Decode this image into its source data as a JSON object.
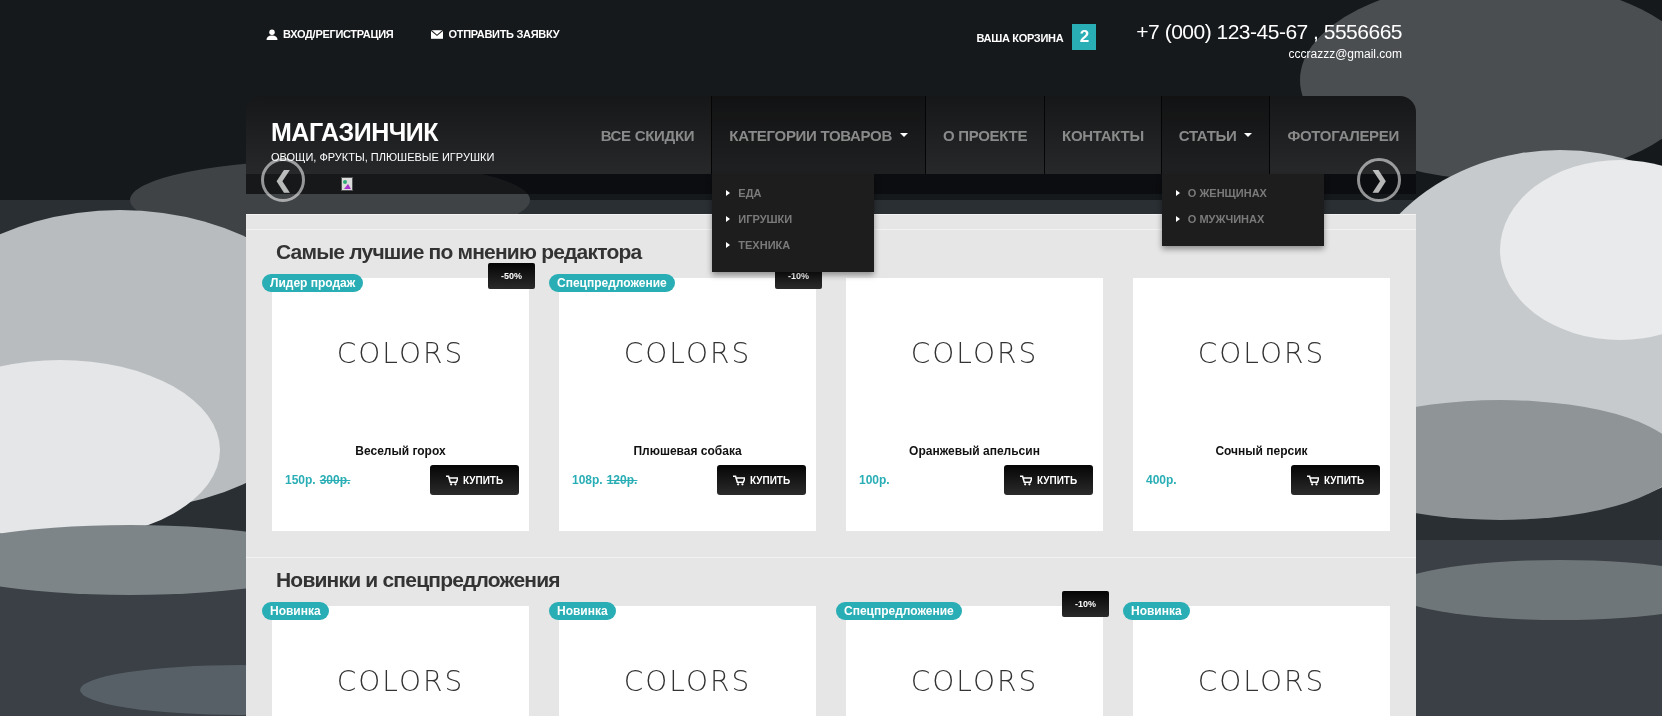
{
  "top_bar": {
    "login_link": "ВХОД/РЕГИСТРАЦИЯ",
    "request_link": "ОТПРАВИТЬ ЗАЯВКУ",
    "cart": {
      "label": "ВАША КОРЗИНА",
      "count": "2"
    },
    "phone": "+7 (000) 123-45-67 , 5556665",
    "email": "cccrazzz@gmail.com"
  },
  "header": {
    "logo": "МАГАЗИНЧИК",
    "tagline": "ОВОЩИ, ФРУКТЫ, ПЛЮШЕВЫЕ ИГРУШКИ",
    "nav": [
      {
        "label": "ВСЕ СКИДКИ"
      },
      {
        "label": "КАТЕГОРИИ ТОВАРОВ",
        "expanded": true,
        "menu": [
          "ЕДА",
          "ИГРУШКИ",
          "ТЕХНИКА"
        ]
      },
      {
        "label": "О ПРОЕКТЕ"
      },
      {
        "label": "КОНТАКТЫ"
      },
      {
        "label": "СТАТЬИ",
        "expanded": true,
        "menu": [
          "О ЖЕНЩИНАХ",
          "О МУЖЧИНАХ"
        ]
      },
      {
        "label": "ФОТОГАЛЕРЕИ"
      }
    ]
  },
  "slider": {
    "prev": "❮",
    "next": "❯"
  },
  "sections": [
    {
      "title": "Самые лучшие по мнению редактора",
      "products": [
        {
          "badge": "Лидер продаж",
          "discount": "-50%",
          "image_text": "COLORS",
          "name": "Веселый горох",
          "price": "150р.",
          "old_price": "300р.",
          "button": "КУПИТЬ"
        },
        {
          "badge": "Спецпредложение",
          "discount": "-10%",
          "image_text": "COLORS",
          "name": "Плюшевая собака",
          "price": "108р.",
          "old_price": "120р.",
          "button": "КУПИТЬ"
        },
        {
          "image_text": "COLORS",
          "name": "Оранжевый апельсин",
          "price": "100р.",
          "button": "КУПИТЬ"
        },
        {
          "image_text": "COLORS",
          "name": "Сочный персик",
          "price": "400р.",
          "button": "КУПИТЬ"
        }
      ]
    },
    {
      "title": "Новинки и спецпредложения",
      "products": [
        {
          "badge": "Новинка",
          "image_text": "COLORS"
        },
        {
          "badge": "Новинка",
          "image_text": "COLORS"
        },
        {
          "badge": "Спецпредложение",
          "discount": "-10%",
          "image_text": "COLORS"
        },
        {
          "badge": "Новинка",
          "image_text": "COLORS"
        }
      ]
    }
  ]
}
